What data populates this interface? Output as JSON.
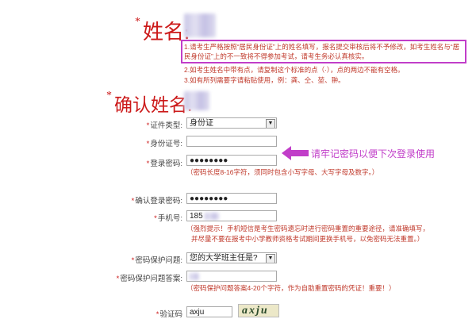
{
  "name_section": {
    "label": "姓名:",
    "notes": [
      "1.请考生严格按照“居民身份证”上的姓名填写，报名提交审核后将不予修改，如考生姓名与“居民身份证”上的不一致将不得参加考试，请考生务必认真核实。",
      "2.如考生姓名中带有点，请复制这个标准的点（·），点的两边不能有空格。",
      "3.如有所列需要字请粘贴使用，例：龚、仝、堃、翀。"
    ]
  },
  "confirm_name": {
    "label": "确认姓名:"
  },
  "form": {
    "id_type": {
      "label": "证件类型:",
      "value": "身份证"
    },
    "id_number": {
      "label": "身份证号:"
    },
    "password": {
      "label": "登录密码:",
      "value": "●●●●●●●●",
      "note": "（密码长度8-16字符，须同时包含小写字母、大写字母及数字。）"
    },
    "confirm_password": {
      "label": "确认登录密码:",
      "value": "●●●●●●●●"
    },
    "phone": {
      "label": "手机号:",
      "value": "185",
      "note_line1": "（强烈提示！手机短信是考生密码遗忘时进行密码重置的重要途径，请准确填写，",
      "note_line2": "并尽量不要在报考中小学教师资格考试期间更换手机号，以免密码无法重置。）"
    },
    "security_question": {
      "label": "密码保护问题:",
      "value": "您的大学班主任是?"
    },
    "security_answer": {
      "label": "密码保护问题答案:",
      "note": "（密码保护问题答案4-20个字符，作为自助重置密码的凭证！重要！）"
    },
    "captcha": {
      "label": "验证码",
      "value": "axju",
      "image_text": "axju"
    }
  },
  "annotation": {
    "text": "请牢记密码以便下次登录使用",
    "color": "#c13ec9"
  },
  "colors": {
    "label_red": "#cc1a1a",
    "note_red": "#c0392b",
    "highlight": "#c13ec9"
  },
  "required_mark": "*"
}
